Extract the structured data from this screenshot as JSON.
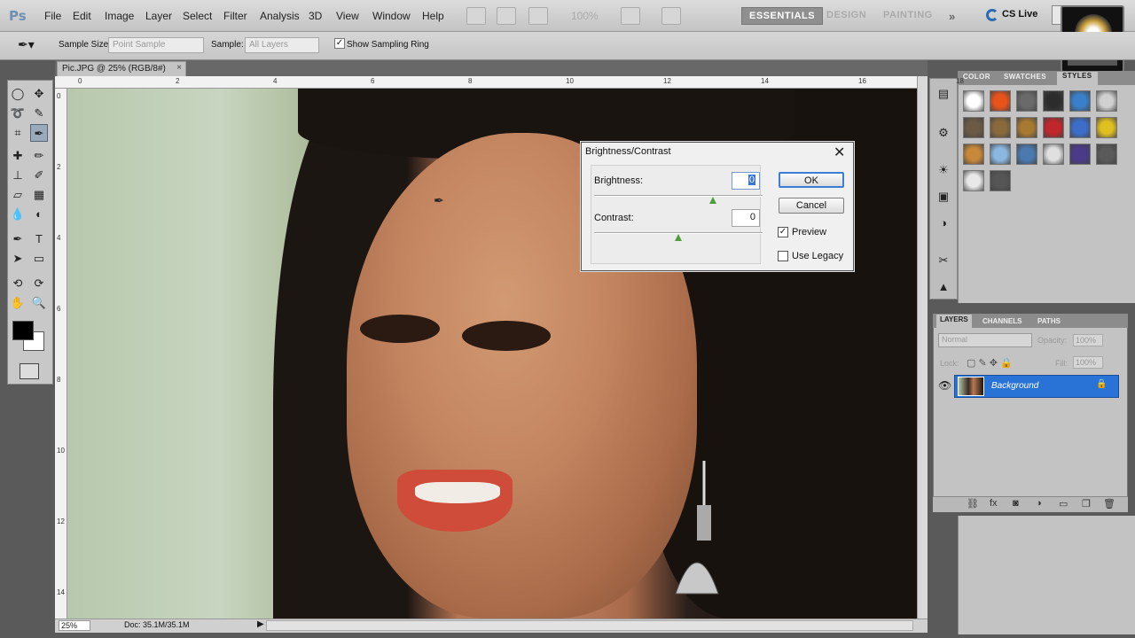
{
  "app": {
    "logo": "Ps"
  },
  "menu": [
    "File",
    "Edit",
    "Image",
    "Layer",
    "Select",
    "Filter",
    "Analysis",
    "3D",
    "View",
    "Window",
    "Help"
  ],
  "zoom_menu": "100%",
  "workspaces": {
    "essentials": "ESSENTIALS",
    "design": "DESIGN",
    "painting": "PAINTING",
    "more": "»"
  },
  "cslive": "CS Live",
  "options_bar": {
    "sample_size_label": "Sample Size:",
    "sample_size_value": "Point Sample",
    "sample_label": "Sample:",
    "sample_value": "All Layers",
    "show_ring_label": "Show Sampling Ring",
    "show_ring_checked": "✓"
  },
  "document": {
    "tab_title": "Pic.JPG @ 25% (RGB/8#)",
    "tab_close": "×"
  },
  "ruler_top": [
    "0",
    "2",
    "4",
    "6",
    "8",
    "10",
    "12",
    "14",
    "16",
    "18"
  ],
  "ruler_left": [
    "0",
    "2",
    "4",
    "6",
    "8",
    "10",
    "12",
    "14"
  ],
  "status": {
    "zoom": "25%",
    "doc_info": "Doc: 35.1M/35.1M",
    "arrow": "▶"
  },
  "styles_panel": {
    "tabs": [
      "COLOR",
      "SWATCHES",
      "STYLES"
    ],
    "swatches": [
      "#ffffff",
      "#e8531c",
      "#6a6a6a",
      "#2c2c2c",
      "#3a7fc9",
      "#d0d0d0",
      "#6b5a44",
      "#8a6a3a",
      "#a87a30",
      "#c0262a",
      "#3c6ec9",
      "#e0c020",
      "#c8883a",
      "#8ab8e0",
      "#4a7ab0",
      "#e0e0e0",
      "#4a3a8a",
      "#5a5a5a",
      "#e8e8e8",
      "#555555"
    ]
  },
  "layers_panel": {
    "tabs": [
      "LAYERS",
      "CHANNELS",
      "PATHS"
    ],
    "blend_mode": "Normal",
    "opacity_label": "Opacity:",
    "opacity_value": "100%",
    "lock_label": "Lock:",
    "fill_label": "Fill:",
    "fill_value": "100%",
    "layer_name": "Background",
    "lock_icon": "🔒"
  },
  "dialog": {
    "title": "Brightness/Contrast",
    "close": "✕",
    "brightness_label": "Brightness:",
    "brightness_value": "0",
    "contrast_label": "Contrast:",
    "contrast_value": "0",
    "ok": "OK",
    "cancel": "Cancel",
    "preview_label": "Preview",
    "preview_check": "✓",
    "legacy_label": "Use Legacy",
    "legacy_check": ""
  },
  "colors": {
    "accent": "#2a73d6",
    "fg": "#000000",
    "bg": "#ffffff"
  }
}
